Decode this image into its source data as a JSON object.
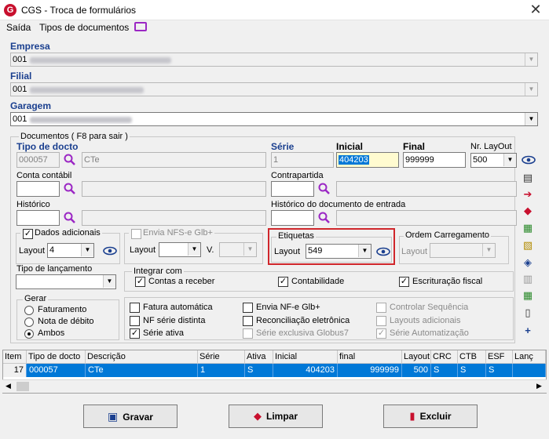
{
  "window": {
    "title": "CGS - Troca de formulários"
  },
  "menu": {
    "saida": "Saída",
    "tipos_documentos": "Tipos de documentos"
  },
  "empresa": {
    "label": "Empresa",
    "value": "001"
  },
  "filial": {
    "label": "Filial",
    "value": "001"
  },
  "garagem": {
    "label": "Garagem",
    "value": "001"
  },
  "documentos": {
    "group_label": "Documentos ( F8 para sair )",
    "tipo_docto_label": "Tipo de docto",
    "tipo_docto_code": "000057",
    "tipo_docto_desc": "CTe",
    "serie_label": "Série",
    "serie_value": "1",
    "inicial_label": "Inicial",
    "inicial_value": "404203",
    "final_label": "Final",
    "final_value": "999999",
    "nr_layout_label": "Nr. LayOut",
    "nr_layout_value": "500",
    "conta_contabil_label": "Conta contábil",
    "contrapartida_label": "Contrapartida",
    "historico_label": "Histórico",
    "historico_entrada_label": "Histórico do documento de entrada"
  },
  "dados_adicionais": {
    "label": "Dados adicionais",
    "checked": true,
    "layout_label": "Layout",
    "layout_value": "4"
  },
  "envia_nfs": {
    "label": "Envia NFS-e Glb+",
    "layout_label": "Layout",
    "v_label": "V."
  },
  "etiquetas": {
    "label": "Etiquetas",
    "layout_label": "Layout",
    "layout_value": "549"
  },
  "ordem_carregamento": {
    "label": "Ordem Carregamento",
    "layout_label": "Layout"
  },
  "tipo_lancamento": {
    "label": "Tipo de lançamento"
  },
  "integrar": {
    "label": "Integrar com",
    "contas_receber": "Contas a receber",
    "contabilidade": "Contabilidade",
    "escrituracao": "Escrituração fiscal"
  },
  "gerar": {
    "label": "Gerar",
    "faturamento": "Faturamento",
    "nota_debito": "Nota de débito",
    "ambos": "Ambos",
    "selected": "Ambos"
  },
  "options": {
    "fatura_automatica": "Fatura automática",
    "nf_serie_distinta": "NF série distinta",
    "serie_ativa": "Série ativa",
    "envia_nfe": "Envia NF-e Glb+",
    "reconciliacao": "Reconciliação eletrônica",
    "serie_exclusiva": "Série exclusiva Globus7",
    "controlar_sequencia": "Controlar Sequência",
    "layouts_adicionais": "Layouts adicionais",
    "serie_automatizacao": "Série Automatização"
  },
  "grid": {
    "columns": [
      "Item",
      "Tipo de docto",
      "Descrição",
      "Série",
      "Ativa",
      "Inicial",
      "final",
      "Layout",
      "CRC",
      "CTB",
      "ESF",
      "Lanç"
    ],
    "rows": [
      [
        "17",
        "000057",
        "CTe",
        "1",
        "S",
        "404203",
        "999999",
        "500",
        "S",
        "S",
        "S",
        ""
      ]
    ]
  },
  "buttons": {
    "gravar": "Gravar",
    "limpar": "Limpar",
    "excluir": "Excluir"
  },
  "colors": {
    "label_blue": "#1a3f8f",
    "selection_blue": "#0078d7",
    "highlight_red": "#d0262b"
  }
}
